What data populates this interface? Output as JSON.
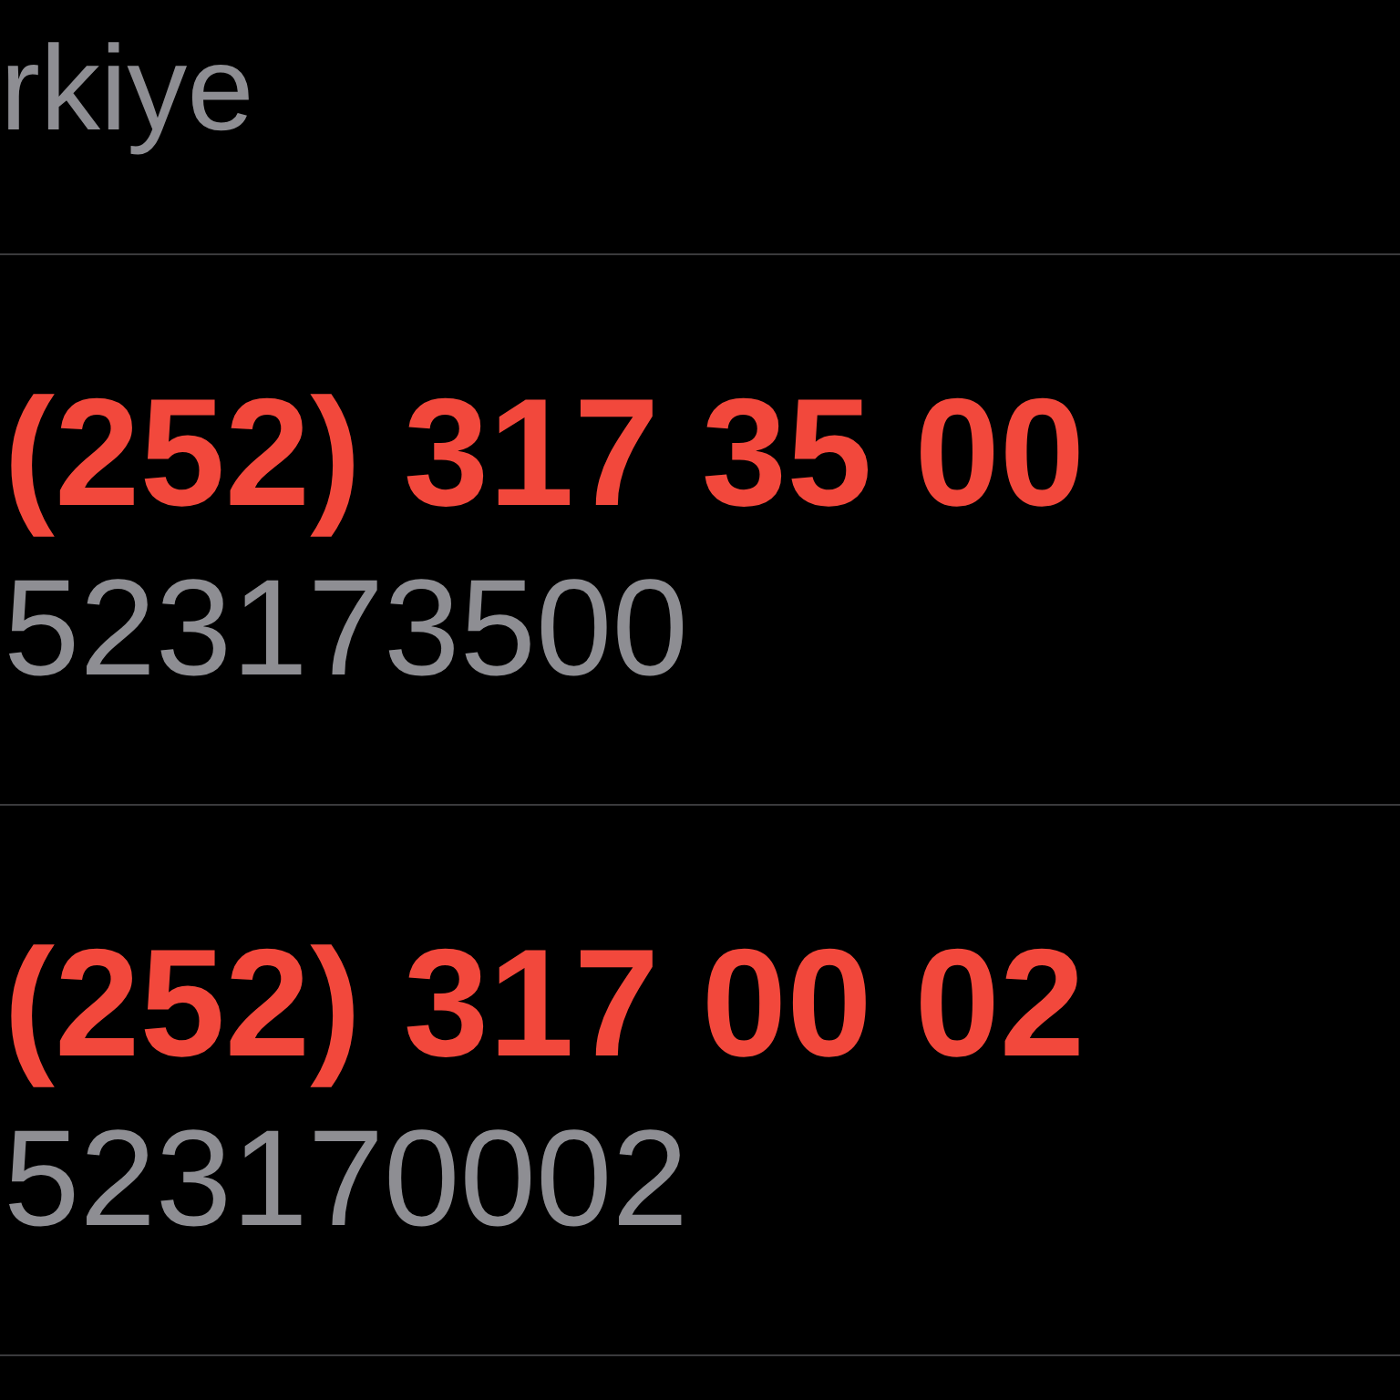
{
  "header": {
    "text": "rkiye"
  },
  "phones": [
    {
      "number": "(252) 317 35 00",
      "raw": "523173500"
    },
    {
      "number": "(252) 317 00 02",
      "raw": "523170002"
    }
  ]
}
